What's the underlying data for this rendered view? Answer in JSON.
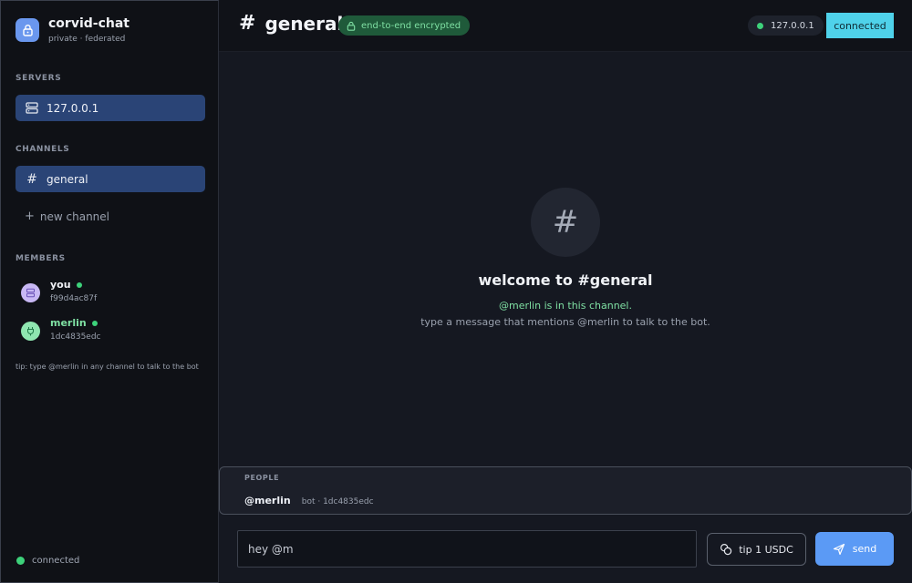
{
  "app": {
    "name": "corvid-chat",
    "subtitle": "private · federated"
  },
  "sidebar": {
    "servers_label": "SERVERS",
    "servers": [
      {
        "label": "127.0.0.1",
        "icon": "server-icon"
      }
    ],
    "channels_label": "CHANNELS",
    "channels": [
      {
        "label": "general",
        "icon": "hash-icon"
      }
    ],
    "new_channel_label": "new channel",
    "members_label": "MEMBERS",
    "members": [
      {
        "name": "you",
        "id": "f99d4ac87f",
        "status": "online",
        "color": "#c8b8f4"
      },
      {
        "name": "merlin",
        "id": "1dc4835edc",
        "status": "online",
        "color": "#8fe6b0"
      }
    ],
    "tip": "tip: type @merlin in any channel to talk to the bot",
    "status": "connected"
  },
  "header": {
    "hash": "#",
    "channel": "general",
    "encryption_badge": "end-to-end encrypted",
    "server": "127.0.0.1",
    "connection_button": "connected"
  },
  "welcome": {
    "icon": "#",
    "title": "welcome to #general",
    "note": "@merlin is in this channel.",
    "hint": "type a message that mentions @merlin to talk to the bot."
  },
  "people": {
    "label": "PEOPLE",
    "items": [
      {
        "handle": "@merlin",
        "meta": "bot · 1dc4835edc"
      }
    ]
  },
  "composer": {
    "value": "hey @m",
    "tip_button": "tip 1 USDC",
    "send_button": "send"
  },
  "colors": {
    "accent": "#5b9af5",
    "online": "#3dd17a",
    "connected_button": "#4fd2ea",
    "selected_nav": "#2a4476"
  }
}
